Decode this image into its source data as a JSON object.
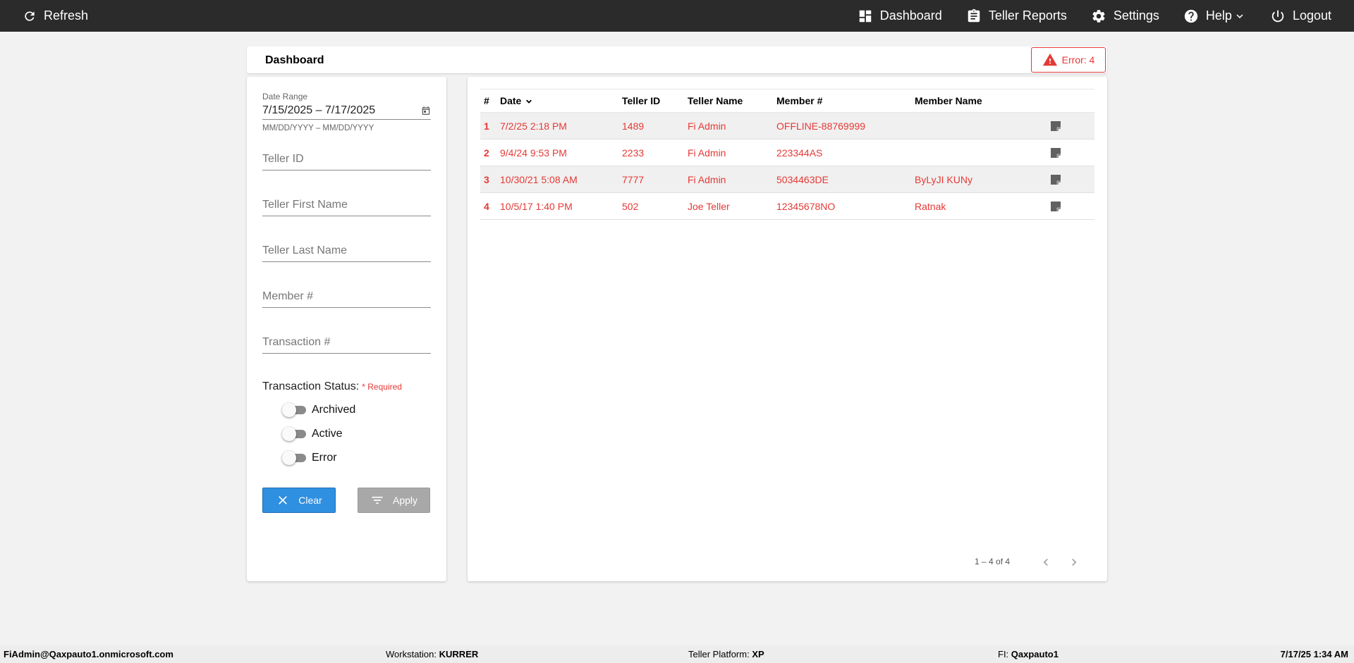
{
  "topbar": {
    "refresh_label": "Refresh",
    "dashboard_label": "Dashboard",
    "teller_reports_label": "Teller Reports",
    "settings_label": "Settings",
    "help_label": "Help",
    "logout_label": "Logout"
  },
  "page": {
    "title": "Dashboard",
    "error_badge": "Error: 4"
  },
  "filters": {
    "date_range_label": "Date Range",
    "date_range_value": "7/15/2025 – 7/17/2025",
    "date_range_hint": "MM/DD/YYYY – MM/DD/YYYY",
    "teller_id_placeholder": "Teller ID",
    "teller_first_name_placeholder": "Teller First Name",
    "teller_last_name_placeholder": "Teller Last Name",
    "member_placeholder": "Member #",
    "transaction_placeholder": "Transaction #",
    "status_label": "Transaction Status:",
    "required_label": "* Required",
    "toggles": [
      {
        "label": "Archived",
        "on": false
      },
      {
        "label": "Active",
        "on": false
      },
      {
        "label": "Error",
        "on": false
      }
    ],
    "clear_label": "Clear",
    "apply_label": "Apply"
  },
  "table": {
    "headers": {
      "num": "#",
      "date": "Date",
      "teller_id": "Teller ID",
      "teller_name": "Teller Name",
      "member_num": "Member #",
      "member_name": "Member Name"
    },
    "rows": [
      {
        "num": "1",
        "date": "7/2/25 2:18 PM",
        "teller_id": "1489",
        "teller_name": "Fi Admin",
        "member_num": "OFFLINE-88769999",
        "member_name": ""
      },
      {
        "num": "2",
        "date": "9/4/24 9:53 PM",
        "teller_id": "2233",
        "teller_name": "Fi Admin",
        "member_num": "223344AS",
        "member_name": ""
      },
      {
        "num": "3",
        "date": "10/30/21 5:08 AM",
        "teller_id": "7777",
        "teller_name": "Fi Admin",
        "member_num": "5034463DE",
        "member_name": "ByLyJI KUNy"
      },
      {
        "num": "4",
        "date": "10/5/17 1:40 PM",
        "teller_id": "502",
        "teller_name": "Joe Teller",
        "member_num": "12345678NO",
        "member_name": "Ratnak"
      }
    ],
    "pagination_label": "1 – 4 of 4"
  },
  "statusbar": {
    "user": "FiAdmin@Qaxpauto1.onmicrosoft.com",
    "workstation_label": "Workstation:",
    "workstation_value": "KURRER",
    "platform_label": "Teller Platform:",
    "platform_value": "XP",
    "fi_label": "FI:",
    "fi_value": "Qaxpauto1",
    "datetime": "7/17/25 1:34 AM"
  },
  "colors": {
    "topbar_bg": "#2b2b2b",
    "error_red": "#e53935",
    "clear_blue": "#2f8fe0",
    "apply_gray": "#a8a8a8"
  },
  "icons": {
    "refresh": "refresh-icon",
    "dashboard": "dashboard-icon",
    "teller_reports": "clipboard-icon",
    "settings": "gear-icon",
    "help": "help-circle-icon",
    "logout": "power-icon",
    "error": "warning-icon",
    "note": "note-icon"
  }
}
